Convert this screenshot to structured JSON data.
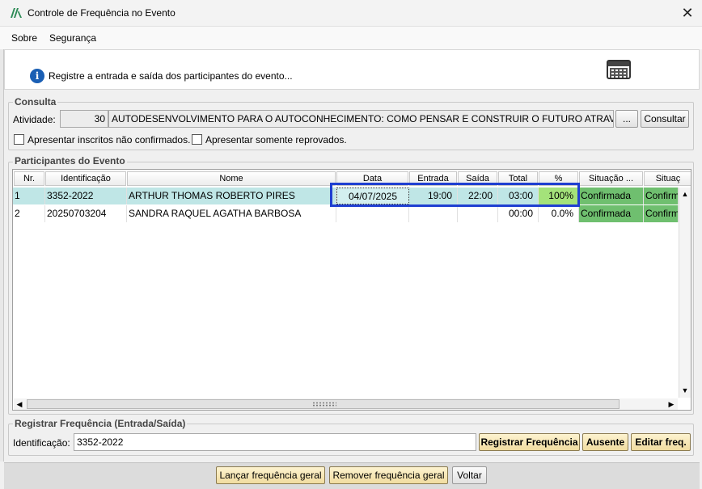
{
  "window": {
    "title": "Controle de Frequência no Evento",
    "close_icon": "close-icon"
  },
  "menu": {
    "items": [
      "Sobre",
      "Segurança"
    ]
  },
  "header": {
    "message": "Registre a entrada e saída dos participantes do evento..."
  },
  "consulta": {
    "label": "Consulta",
    "atividade_label": "Atividade:",
    "atividade_code": "30",
    "atividade_name": "AUTODESENVOLVIMENTO PARA O AUTOCONHECIMENTO: COMO PENSAR E CONSTRUIR O FUTURO ATRAVÉS DE NO",
    "ellipsis_button": "...",
    "consultar_button": "Consultar",
    "check_nao_confirmados": "Apresentar inscritos não confirmados.",
    "check_reprovados": "Apresentar somente reprovados."
  },
  "participantes": {
    "label": "Participantes do Evento",
    "columns": [
      "Nr.",
      "Identificação",
      "Nome",
      "Data",
      "Entrada",
      "Saída",
      "Total",
      "%",
      "Situação ...",
      "Situaç"
    ],
    "rows": [
      {
        "nr": "1",
        "id": "3352-2022",
        "nome": "ARTHUR THOMAS ROBERTO PIRES",
        "data": "04/07/2025",
        "entrada": "19:00",
        "saida": "22:00",
        "total": "03:00",
        "pct": "100%",
        "situacao": "Confirmada",
        "situacao2": "Confirm"
      },
      {
        "nr": "2",
        "id": "20250703204",
        "nome": "SANDRA RAQUEL AGATHA BARBOSA",
        "data": "",
        "entrada": "",
        "saida": "",
        "total": "00:00",
        "pct": "0.0%",
        "situacao": "Confirmada",
        "situacao2": "Confirm"
      }
    ]
  },
  "registrar": {
    "label": "Registrar Frequência (Entrada/Saída)",
    "id_label": "Identificação:",
    "id_value": "3352-2022",
    "registrar_button": "Registrar Frequência",
    "ausente_button": "Ausente",
    "editar_button": "Editar freq."
  },
  "footer": {
    "lancar_button": "Lançar frequência geral",
    "remover_button": "Remover frequência geral",
    "voltar_button": "Voltar"
  },
  "colors": {
    "highlight_border": "#1f3fd1",
    "selected_row": "#bfe6e6",
    "confirmed": "#6fbf6f",
    "pct_full": "#a4e27a"
  }
}
